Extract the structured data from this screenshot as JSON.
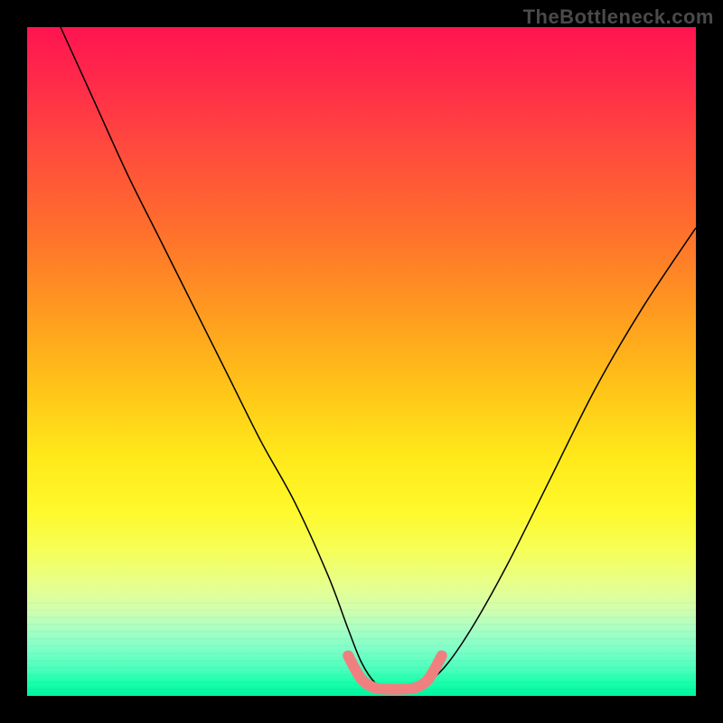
{
  "watermark": "TheBottleneck.com",
  "chart_data": {
    "type": "line",
    "title": "",
    "xlabel": "",
    "ylabel": "",
    "xlim": [
      0,
      100
    ],
    "ylim": [
      0,
      100
    ],
    "annotations": [],
    "series": [
      {
        "name": "black-curve",
        "color": "#000000",
        "width": 1.5,
        "x": [
          5,
          10,
          15,
          20,
          25,
          30,
          35,
          40,
          45,
          48,
          50,
          52,
          54,
          56,
          58,
          60,
          63,
          67,
          72,
          78,
          85,
          92,
          100
        ],
        "y": [
          100,
          89,
          78,
          68,
          58,
          48,
          38,
          29,
          18,
          10,
          5,
          2,
          1,
          1,
          1,
          2,
          5,
          11,
          20,
          32,
          46,
          58,
          70
        ]
      },
      {
        "name": "pink-segment",
        "color": "#f08080",
        "width": 12,
        "x": [
          48,
          50,
          52,
          54,
          56,
          58,
          60,
          62
        ],
        "y": [
          6,
          2.5,
          1.2,
          1,
          1,
          1.2,
          2.5,
          6
        ]
      }
    ],
    "background_gradient": {
      "direction": "vertical",
      "stops": [
        {
          "offset": 0.0,
          "color": "#ff1450"
        },
        {
          "offset": 0.3,
          "color": "#ff6e2d"
        },
        {
          "offset": 0.55,
          "color": "#ffc418"
        },
        {
          "offset": 0.72,
          "color": "#fff82a"
        },
        {
          "offset": 0.88,
          "color": "#d2ffae"
        },
        {
          "offset": 1.0,
          "color": "#00f59e"
        }
      ]
    }
  }
}
